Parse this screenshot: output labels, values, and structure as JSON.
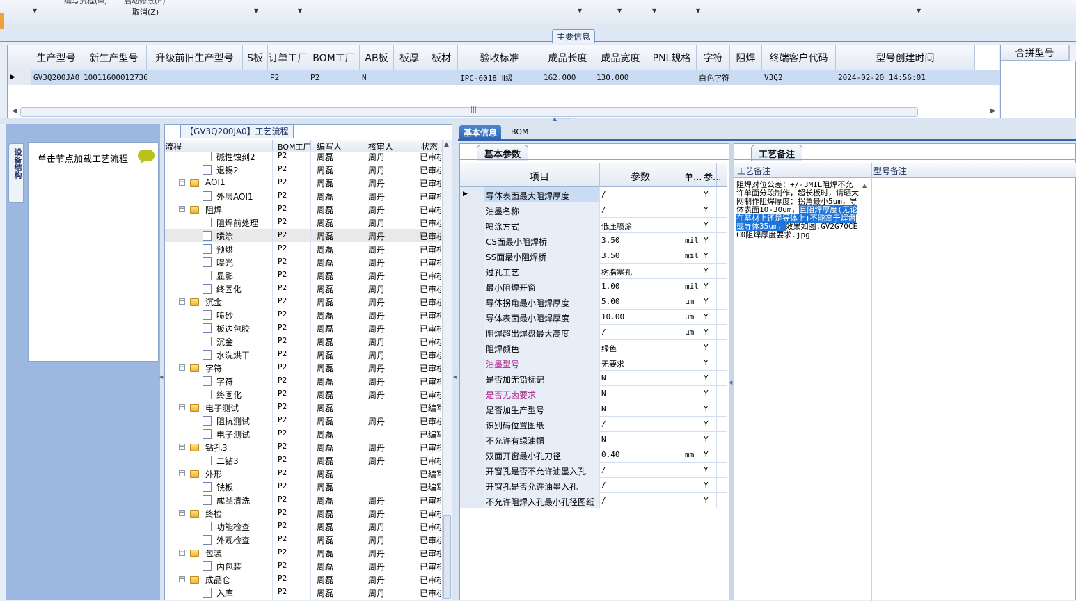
{
  "toolbar": {
    "partial_items": [
      "编写流程(M)",
      "启动修改(E)"
    ],
    "cancel_label": "取消(Z)"
  },
  "main_info": {
    "title": "主要信息",
    "columns": [
      "生产型号",
      "新生产型号",
      "升级前旧生产型号",
      "S板",
      "订单工厂",
      "BOM工厂",
      "AB板",
      "板厚",
      "板材",
      "验收标准",
      "成品长度",
      "成品宽度",
      "PNL规格",
      "字符",
      "阻焊",
      "终端客户代码",
      "型号创建时间"
    ],
    "row": {
      "生产型号": "GV3Q200JA0",
      "新生产型号": "10011600012736",
      "升级前旧生产型号": "",
      "S板": "",
      "订单工厂": "P2",
      "BOM工厂": "P2",
      "AB板": "N",
      "板厚": "",
      "板材": "",
      "验收标准": "IPC-6018 Ⅱ级",
      "成品长度": "162.000",
      "成品宽度": "130.000",
      "PNL规格": "",
      "字符": "白色字符",
      "阻焊": "",
      "终端客户代码": "V3Q2",
      "型号创建时间": "2024-02-20 14:56:01"
    },
    "side_column": "合拼型号"
  },
  "left_panel": {
    "vertical_tab": "设备结构",
    "hint": "单击节点加载工艺流程"
  },
  "process_flow": {
    "title": "【GV3Q200JA0】工艺流程",
    "columns": [
      "流程",
      "BOM工厂",
      "编写人",
      "核审人",
      "状态"
    ],
    "rows": [
      {
        "level": 2,
        "type": "doc",
        "name": "碱性蚀刻2",
        "bom": "P2",
        "writer": "周磊",
        "reviewer": "周丹",
        "status": "已审核"
      },
      {
        "level": 2,
        "type": "doc",
        "name": "退锡2",
        "bom": "P2",
        "writer": "周磊",
        "reviewer": "周丹",
        "status": "已审核"
      },
      {
        "level": 1,
        "type": "folder",
        "name": "AOI1",
        "bom": "P2",
        "writer": "周磊",
        "reviewer": "周丹",
        "status": "已审核"
      },
      {
        "level": 2,
        "type": "doc",
        "name": "外层AOI1",
        "bom": "P2",
        "writer": "周磊",
        "reviewer": "周丹",
        "status": "已审核"
      },
      {
        "level": 1,
        "type": "folder",
        "name": "阻焊",
        "bom": "P2",
        "writer": "周磊",
        "reviewer": "周丹",
        "status": "已审核"
      },
      {
        "level": 2,
        "type": "doc",
        "name": "阻焊前处理",
        "bom": "P2",
        "writer": "周磊",
        "reviewer": "周丹",
        "status": "已审核"
      },
      {
        "level": 2,
        "type": "doc",
        "name": "喷涂",
        "bom": "P2",
        "writer": "周磊",
        "reviewer": "周丹",
        "status": "已审核",
        "selected": true
      },
      {
        "level": 2,
        "type": "doc",
        "name": "预烘",
        "bom": "P2",
        "writer": "周磊",
        "reviewer": "周丹",
        "status": "已审核"
      },
      {
        "level": 2,
        "type": "doc",
        "name": "曝光",
        "bom": "P2",
        "writer": "周磊",
        "reviewer": "周丹",
        "status": "已审核"
      },
      {
        "level": 2,
        "type": "doc",
        "name": "显影",
        "bom": "P2",
        "writer": "周磊",
        "reviewer": "周丹",
        "status": "已审核"
      },
      {
        "level": 2,
        "type": "doc",
        "name": "终固化",
        "bom": "P2",
        "writer": "周磊",
        "reviewer": "周丹",
        "status": "已审核"
      },
      {
        "level": 1,
        "type": "folder",
        "name": "沉金",
        "bom": "P2",
        "writer": "周磊",
        "reviewer": "周丹",
        "status": "已审核"
      },
      {
        "level": 2,
        "type": "doc",
        "name": "喷砂",
        "bom": "P2",
        "writer": "周磊",
        "reviewer": "周丹",
        "status": "已审核"
      },
      {
        "level": 2,
        "type": "doc",
        "name": "板边包胶",
        "bom": "P2",
        "writer": "周磊",
        "reviewer": "周丹",
        "status": "已审核"
      },
      {
        "level": 2,
        "type": "doc",
        "name": "沉金",
        "bom": "P2",
        "writer": "周磊",
        "reviewer": "周丹",
        "status": "已审核"
      },
      {
        "level": 2,
        "type": "doc",
        "name": "水洗烘干",
        "bom": "P2",
        "writer": "周磊",
        "reviewer": "周丹",
        "status": "已审核"
      },
      {
        "level": 1,
        "type": "folder",
        "name": "字符",
        "bom": "P2",
        "writer": "周磊",
        "reviewer": "周丹",
        "status": "已审核"
      },
      {
        "level": 2,
        "type": "doc",
        "name": "字符",
        "bom": "P2",
        "writer": "周磊",
        "reviewer": "周丹",
        "status": "已审核"
      },
      {
        "level": 2,
        "type": "doc",
        "name": "终固化",
        "bom": "P2",
        "writer": "周磊",
        "reviewer": "周丹",
        "status": "已审核"
      },
      {
        "level": 1,
        "type": "folder",
        "name": "电子测试",
        "bom": "P2",
        "writer": "周磊",
        "reviewer": "",
        "status": "已编写"
      },
      {
        "level": 2,
        "type": "doc",
        "name": "阻抗测试",
        "bom": "P2",
        "writer": "周磊",
        "reviewer": "周丹",
        "status": "已审核"
      },
      {
        "level": 2,
        "type": "doc",
        "name": "电子测试",
        "bom": "P2",
        "writer": "周磊",
        "reviewer": "",
        "status": "已编写"
      },
      {
        "level": 1,
        "type": "folder",
        "name": "钻孔3",
        "bom": "P2",
        "writer": "周磊",
        "reviewer": "周丹",
        "status": "已审核"
      },
      {
        "level": 2,
        "type": "doc",
        "name": "二钻3",
        "bom": "P2",
        "writer": "周磊",
        "reviewer": "周丹",
        "status": "已审核"
      },
      {
        "level": 1,
        "type": "folder",
        "name": "外形",
        "bom": "P2",
        "writer": "周磊",
        "reviewer": "",
        "status": "已编写"
      },
      {
        "level": 2,
        "type": "doc",
        "name": "铣板",
        "bom": "P2",
        "writer": "周磊",
        "reviewer": "",
        "status": "已编写"
      },
      {
        "level": 2,
        "type": "doc",
        "name": "成品清洗",
        "bom": "P2",
        "writer": "周磊",
        "reviewer": "周丹",
        "status": "已审核"
      },
      {
        "level": 1,
        "type": "folder",
        "name": "终检",
        "bom": "P2",
        "writer": "周磊",
        "reviewer": "周丹",
        "status": "已审核"
      },
      {
        "level": 2,
        "type": "doc",
        "name": "功能检查",
        "bom": "P2",
        "writer": "周磊",
        "reviewer": "周丹",
        "status": "已审核"
      },
      {
        "level": 2,
        "type": "doc",
        "name": "外观检查",
        "bom": "P2",
        "writer": "周磊",
        "reviewer": "周丹",
        "status": "已审核"
      },
      {
        "level": 1,
        "type": "folder",
        "name": "包装",
        "bom": "P2",
        "writer": "周磊",
        "reviewer": "周丹",
        "status": "已审核"
      },
      {
        "level": 2,
        "type": "doc",
        "name": "内包装",
        "bom": "P2",
        "writer": "周磊",
        "reviewer": "周丹",
        "status": "已审核"
      },
      {
        "level": 1,
        "type": "folder",
        "name": "成品仓",
        "bom": "P2",
        "writer": "周磊",
        "reviewer": "周丹",
        "status": "已审核"
      },
      {
        "level": 2,
        "type": "doc",
        "name": "入库",
        "bom": "P2",
        "writer": "周磊",
        "reviewer": "周丹",
        "status": "已审核"
      }
    ]
  },
  "detail_tabs": [
    "基本信息",
    "BOM"
  ],
  "basic_params": {
    "title": "基本参数",
    "columns": [
      "项目",
      "参数",
      "单...",
      "参..."
    ],
    "rows": [
      {
        "item": "导体表面最大阻焊厚度",
        "value": "/",
        "unit": "",
        "flag": "Y",
        "current": true
      },
      {
        "item": "油墨名称",
        "value": "/",
        "unit": "",
        "flag": "Y"
      },
      {
        "item": "喷涂方式",
        "value": "低压喷涂",
        "unit": "",
        "flag": "Y"
      },
      {
        "item": "CS面最小阻焊桥",
        "value": "3.50",
        "unit": "mil",
        "flag": "Y"
      },
      {
        "item": "SS面最小阻焊桥",
        "value": "3.50",
        "unit": "mil",
        "flag": "Y"
      },
      {
        "item": "过孔工艺",
        "value": "树脂塞孔",
        "unit": "",
        "flag": "Y"
      },
      {
        "item": "最小阻焊开窗",
        "value": "1.00",
        "unit": "mil",
        "flag": "Y"
      },
      {
        "item": "导体拐角最小阻焊厚度",
        "value": "5.00",
        "unit": "μm",
        "flag": "Y"
      },
      {
        "item": "导体表面最小阻焊厚度",
        "value": "10.00",
        "unit": "μm",
        "flag": "Y"
      },
      {
        "item": "阻焊超出焊盘最大高度",
        "value": "/",
        "unit": "μm",
        "flag": "Y"
      },
      {
        "item": "阻焊颜色",
        "value": "绿色",
        "unit": "",
        "flag": "Y"
      },
      {
        "item": "油墨型号",
        "value": "无要求",
        "unit": "",
        "flag": "Y",
        "highlight": true
      },
      {
        "item": "是否加无铅标记",
        "value": "N",
        "unit": "",
        "flag": "Y"
      },
      {
        "item": "是否无卤要求",
        "value": "N",
        "unit": "",
        "flag": "Y",
        "highlight": true
      },
      {
        "item": "是否加生产型号",
        "value": "N",
        "unit": "",
        "flag": "Y"
      },
      {
        "item": "识别码位置图纸",
        "value": "/",
        "unit": "",
        "flag": "Y"
      },
      {
        "item": "不允许有绿油帽",
        "value": "N",
        "unit": "",
        "flag": "Y"
      },
      {
        "item": "双面开窗最小孔刀径",
        "value": "0.40",
        "unit": "mm",
        "flag": "Y"
      },
      {
        "item": "开窗孔是否不允许油墨入孔",
        "value": "/",
        "unit": "",
        "flag": "Y"
      },
      {
        "item": "开窗孔是否允许油墨入孔",
        "value": "/",
        "unit": "",
        "flag": "Y"
      },
      {
        "item": "不允许阻焊入孔最小孔径图纸",
        "value": "/",
        "unit": "",
        "flag": "Y"
      }
    ]
  },
  "process_notes": {
    "title": "工艺备注",
    "col_notes": "工艺备注",
    "col_model_notes": "型号备注",
    "text_before": "阻焊对位公差：+/-3MIL阻焊不允许单面分段制作，超长板时，请晒大网制作阻焊厚度：拐角最小5um，导体表面10-30um，",
    "text_selected": "且阻焊厚度(无论在基材上还是导体上)不能高于焊盘或导体35um，",
    "text_after": "效果如图.GV2G70CEC0阻焊厚度要求.jpg"
  },
  "colors": {
    "selection": "#c9dcf3",
    "highlight_text": "#b0208a",
    "text_selection_bg": "#1e74d8"
  }
}
